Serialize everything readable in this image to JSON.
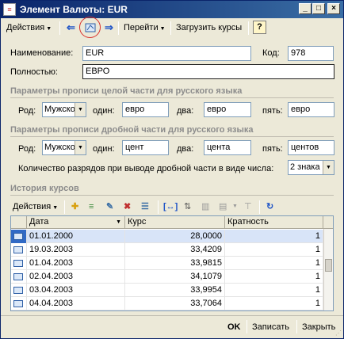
{
  "title": "Элемент Валюты: EUR",
  "toolbar": {
    "actions": "Действия",
    "goto": "Перейти",
    "load_rates": "Загрузить курсы",
    "help": "?"
  },
  "form": {
    "name_label": "Наименование:",
    "name_value": "EUR",
    "code_label": "Код:",
    "code_value": "978",
    "full_label": "Полностью:",
    "full_value": "ЕВРО"
  },
  "integer_section": {
    "title": "Параметры прописи целой части для русского языка",
    "gender_label": "Род:",
    "gender_value": "Мужско",
    "one_label": "один:",
    "one_value": "евро",
    "two_label": "два:",
    "two_value": "евро",
    "five_label": "пять:",
    "five_value": "евро"
  },
  "fraction_section": {
    "title": "Параметры прописи дробной части для русского языка",
    "gender_label": "Род:",
    "gender_value": "Мужско",
    "one_label": "один:",
    "one_value": "цент",
    "two_label": "два:",
    "two_value": "цента",
    "five_label": "пять:",
    "five_value": "центов",
    "digits_label": "Количество разрядов при выводе дробной части в виде числа:",
    "digits_value": "2 знака"
  },
  "history": {
    "title": "История курсов",
    "actions": "Действия",
    "columns": [
      "Дата",
      "Курс",
      "Кратность"
    ],
    "rows": [
      {
        "date": "01.01.2000",
        "rate": "28,0000",
        "mult": "1"
      },
      {
        "date": "19.03.2003",
        "rate": "33,4209",
        "mult": "1"
      },
      {
        "date": "01.04.2003",
        "rate": "33,9815",
        "mult": "1"
      },
      {
        "date": "02.04.2003",
        "rate": "34,1079",
        "mult": "1"
      },
      {
        "date": "03.04.2003",
        "rate": "33,9954",
        "mult": "1"
      },
      {
        "date": "04.04.2003",
        "rate": "33,7064",
        "mult": "1"
      }
    ]
  },
  "buttons": {
    "ok": "OK",
    "save": "Записать",
    "close": "Закрыть"
  }
}
